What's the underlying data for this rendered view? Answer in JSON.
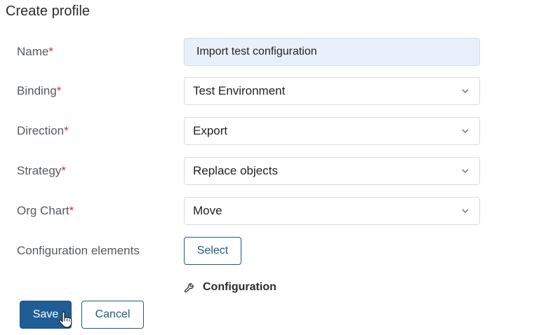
{
  "page": {
    "title": "Create profile"
  },
  "form": {
    "required_mark": "*",
    "name": {
      "label": "Name",
      "value": "Import test configuration"
    },
    "binding": {
      "label": "Binding",
      "value": "Test Environment"
    },
    "direction": {
      "label": "Direction",
      "value": "Export"
    },
    "strategy": {
      "label": "Strategy",
      "value": "Replace objects"
    },
    "org_chart": {
      "label": "Org Chart",
      "value": "Move"
    },
    "configuration_elements": {
      "label": "Configuration elements",
      "select_label": "Select"
    },
    "configuration": {
      "icon": "wrench-icon",
      "label": "Configuration"
    }
  },
  "actions": {
    "save_label": "Save",
    "cancel_label": "Cancel"
  },
  "colors": {
    "primary": "#1f5e94",
    "required": "#d0312d",
    "input_fill": "#e8f0fb"
  }
}
